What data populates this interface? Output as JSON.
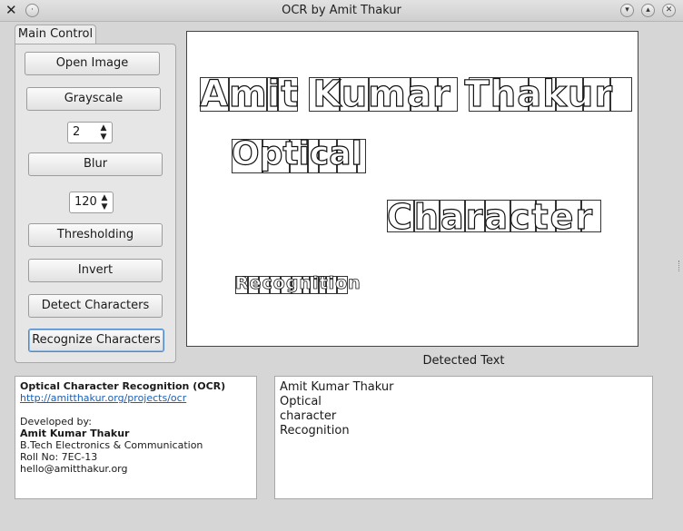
{
  "window": {
    "title": "OCR by Amit Thakur",
    "app_icon": "x-logo-icon",
    "buttons": [
      "minimize-icon",
      "maximize-icon",
      "close-icon"
    ]
  },
  "tab": {
    "label": "Main Control"
  },
  "controls": {
    "open_image": "Open Image",
    "grayscale": "Grayscale",
    "blur_value": "2",
    "blur": "Blur",
    "threshold_value": "120",
    "thresholding": "Thresholding",
    "invert": "Invert",
    "detect_characters": "Detect Characters",
    "recognize_characters": "Recognize Characters"
  },
  "canvas": {
    "words": [
      "Amit Kumar Thakur",
      "Optical",
      "Character",
      "Recognition"
    ]
  },
  "detected": {
    "label": "Detected Text",
    "lines": [
      "Amit Kumar Thakur",
      "Optical",
      "character",
      "Recognition"
    ]
  },
  "info": {
    "heading": "Optical Character Recognition (OCR)",
    "link": "http://amitthakur.org/projects/ocr",
    "developed_by": "Developed by:",
    "author": "Amit Kumar Thakur",
    "degree": "B.Tech Electronics & Communication",
    "roll": "Roll No: 7EC-13",
    "email": "hello@amitthakur.org"
  }
}
